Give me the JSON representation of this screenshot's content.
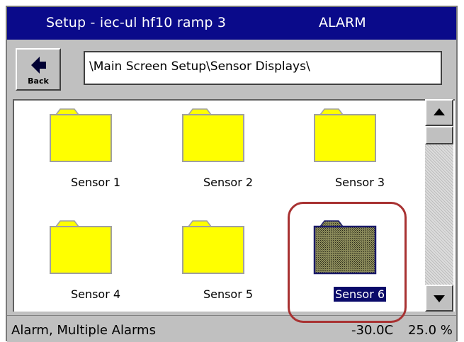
{
  "window": {
    "title": "Setup - iec-ul hf10 ramp 3",
    "status": "ALARM"
  },
  "toolbar": {
    "back_label": "Back",
    "path": "\\Main Screen Setup\\Sensor Displays\\"
  },
  "folders": [
    {
      "label": "Sensor 1"
    },
    {
      "label": "Sensor 2"
    },
    {
      "label": "Sensor 3"
    },
    {
      "label": "Sensor 4"
    },
    {
      "label": "Sensor 5"
    },
    {
      "label": "Sensor 6",
      "selected": true
    }
  ],
  "statusbar": {
    "message": "Alarm, Multiple Alarms",
    "temperature": "-30.0C",
    "percent": "25.0 %"
  },
  "colors": {
    "titlebar": "#0a0a8a",
    "folder": "#ffff00",
    "folder_selected": "#5f5f3a",
    "highlight": "#a83232",
    "selection": "#0a0a6a"
  },
  "icons": {
    "back": "left-arrow-icon",
    "folder": "folder-icon",
    "scroll_up": "triangle-up-icon",
    "scroll_down": "triangle-down-icon"
  }
}
